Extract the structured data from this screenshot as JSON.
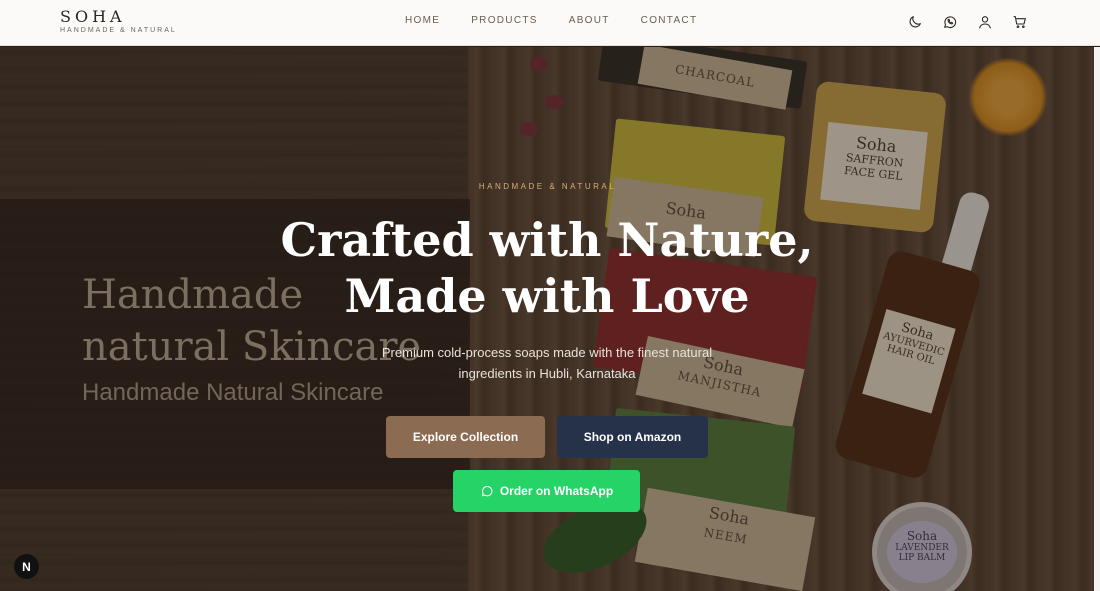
{
  "brand": {
    "name": "SOHA",
    "tagline": "HANDMADE & NATURAL"
  },
  "nav": {
    "items": [
      {
        "label": "HOME"
      },
      {
        "label": "PRODUCTS"
      },
      {
        "label": "ABOUT"
      },
      {
        "label": "CONTACT"
      }
    ]
  },
  "header_icons": [
    "moon-icon",
    "whatsapp-icon",
    "user-icon",
    "cart-icon"
  ],
  "hero": {
    "eyebrow": "HANDMADE & NATURAL",
    "headline_line1": "Crafted with Nature,",
    "headline_line2": "Made with Love",
    "subtext_line1": "Premium cold-process soaps made with the finest natural",
    "subtext_line2": "ingredients in Hubli, Karnataka",
    "banner_title_line1": "Handmade",
    "banner_title_line2": "natural Skincare",
    "banner_subtitle": "Handmade Natural Skincare",
    "buttons": {
      "explore": "Explore Collection",
      "amazon": "Shop on Amazon",
      "whatsapp": "Order on WhatsApp"
    }
  },
  "products": {
    "charcoal": {
      "brand": "Soha",
      "name": "CHARCOAL"
    },
    "manjistha": {
      "brand": "Soha",
      "name": "MANJISTHA"
    },
    "neem": {
      "brand": "Soha",
      "name": "NEEM"
    },
    "face_gel": {
      "brand": "Soha",
      "name1": "SAFFRON",
      "name2": "FACE GEL"
    },
    "hair_oil": {
      "brand": "Soha",
      "name1": "AYURVEDIC",
      "name2": "HAIR OIL"
    },
    "lip_balm": {
      "brand": "Soha",
      "name1": "LAVENDER",
      "name2": "LIP BALM"
    },
    "soap_yellow": {
      "brand": "Soha"
    }
  },
  "badge": {
    "label": "N"
  },
  "colors": {
    "explore_button": "#8b6b52",
    "amazon_button": "#26324a",
    "whatsapp_button": "#25d366",
    "eyebrow": "#d6ad74"
  }
}
